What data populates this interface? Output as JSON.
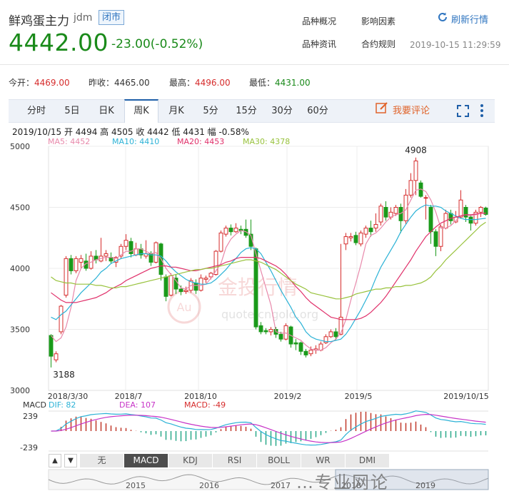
{
  "header": {
    "name": "鲜鸡蛋主力",
    "code": "jdm",
    "status": "闭市",
    "price": "4442.00",
    "change": "-23.00(-0.52%)",
    "links": [
      "品种概况",
      "影响因素",
      "品种资讯",
      "合约规则"
    ],
    "refresh_label": "刷新行情",
    "timestamp": "2019-10-15 11:29:59"
  },
  "stats": [
    {
      "label": "今开：",
      "value": "4469.00",
      "color": "#d62c2c"
    },
    {
      "label": "昨收：",
      "value": "4465.00",
      "color": "#333333"
    },
    {
      "label": "最高：",
      "value": "4496.00",
      "color": "#d62c2c"
    },
    {
      "label": "最低：",
      "value": "4431.00",
      "color": "#1a8a1a"
    }
  ],
  "tabs": [
    "分时",
    "5日",
    "日K",
    "周K",
    "月K",
    "5分",
    "15分",
    "30分",
    "60分"
  ],
  "active_tab": "周K",
  "comment_label": "我要评论",
  "ohlc_line": "2019/10/15 开 4494 高 4505 收 4442 低 4431 幅 -0.58%",
  "ma_legend": [
    {
      "text": "MA5: 4452",
      "color": "#e889ab"
    },
    {
      "text": "MA10: 4410",
      "color": "#2bb2d6"
    },
    {
      "text": "MA20: 4453",
      "color": "#e0306a"
    },
    {
      "text": "MA30: 4378",
      "color": "#98c23c"
    }
  ],
  "watermark": {
    "cn": "金投行情",
    "en": "quote.cngold.org",
    "badge": "Au"
  },
  "chart_data": {
    "type": "candlestick",
    "y_ticks": [
      "5000",
      "4500",
      "4000",
      "3500",
      "3000"
    ],
    "ylim": [
      3000,
      5000
    ],
    "x_ticks": [
      "2018/3/30",
      "2018/7",
      "2018/10",
      "2019/2",
      "2019/5",
      "2019/10/15"
    ],
    "annotations": {
      "high": "4908",
      "low": "3188"
    },
    "candles": [
      [
        3450,
        3280,
        3460,
        3188
      ],
      [
        3250,
        3300,
        3320,
        3230
      ],
      [
        3480,
        3690,
        3700,
        3460
      ],
      [
        3780,
        4080,
        4100,
        3760
      ],
      [
        4080,
        3980,
        4110,
        3950
      ],
      [
        3980,
        4080,
        4100,
        3960
      ],
      [
        4050,
        4080,
        4110,
        4000
      ],
      [
        4060,
        4000,
        4120,
        3980
      ],
      [
        4000,
        4100,
        4140,
        3990
      ],
      [
        4100,
        4070,
        4150,
        4040
      ],
      [
        4060,
        4100,
        4250,
        4050
      ],
      [
        4100,
        4120,
        4150,
        4060
      ],
      [
        4090,
        4060,
        4130,
        4040
      ],
      [
        4050,
        4090,
        4100,
        4010
      ],
      [
        4100,
        4180,
        4200,
        4080
      ],
      [
        4180,
        4230,
        4280,
        4150
      ],
      [
        4220,
        4120,
        4250,
        4090
      ],
      [
        4110,
        4160,
        4210,
        4100
      ],
      [
        4160,
        4110,
        4200,
        4080
      ],
      [
        4100,
        4120,
        4230,
        4080
      ],
      [
        4120,
        4050,
        4140,
        4020
      ],
      [
        4050,
        4210,
        4220,
        4040
      ],
      [
        4200,
        3950,
        4210,
        3900
      ],
      [
        3930,
        3770,
        3950,
        3730
      ],
      [
        3780,
        3940,
        3960,
        3770
      ],
      [
        3920,
        3830,
        3950,
        3790
      ],
      [
        3830,
        3810,
        3860,
        3780
      ],
      [
        3810,
        3820,
        3850,
        3790
      ],
      [
        3820,
        3900,
        3920,
        3800
      ],
      [
        3880,
        3820,
        3910,
        3790
      ],
      [
        3820,
        3920,
        3950,
        3810
      ],
      [
        3910,
        3920,
        3940,
        3880
      ],
      [
        3930,
        3960,
        3970,
        3910
      ],
      [
        3950,
        4140,
        4150,
        3940
      ],
      [
        4140,
        4290,
        4310,
        4130
      ],
      [
        4280,
        4330,
        4350,
        4260
      ],
      [
        4330,
        4300,
        4360,
        4270
      ],
      [
        4300,
        4330,
        4370,
        4290
      ],
      [
        4320,
        4310,
        4350,
        4280
      ],
      [
        4320,
        4270,
        4400,
        4250
      ],
      [
        4280,
        4180,
        4400,
        4150
      ],
      [
        4160,
        3520,
        4170,
        3500
      ],
      [
        3530,
        3480,
        3560,
        3460
      ],
      [
        3490,
        3480,
        3510,
        3460
      ],
      [
        3480,
        3500,
        3520,
        3450
      ],
      [
        3500,
        3460,
        3520,
        3430
      ],
      [
        3460,
        3420,
        3480,
        3400
      ],
      [
        3420,
        3530,
        3550,
        3410
      ],
      [
        3520,
        3380,
        3530,
        3350
      ],
      [
        3390,
        3380,
        3420,
        3330
      ],
      [
        3390,
        3320,
        3400,
        3290
      ],
      [
        3320,
        3290,
        3340,
        3270
      ],
      [
        3300,
        3330,
        3360,
        3280
      ],
      [
        3330,
        3340,
        3370,
        3300
      ],
      [
        3330,
        3380,
        3400,
        3320
      ],
      [
        3390,
        3440,
        3460,
        3380
      ],
      [
        3440,
        3480,
        3500,
        3430
      ],
      [
        3480,
        3440,
        3510,
        3410
      ],
      [
        3460,
        3600,
        4200,
        3450
      ],
      [
        4200,
        4260,
        4290,
        4150
      ],
      [
        4250,
        4260,
        4290,
        4220
      ],
      [
        4270,
        4210,
        4300,
        4190
      ],
      [
        4200,
        4290,
        4310,
        4180
      ],
      [
        4280,
        4330,
        4350,
        4250
      ],
      [
        4330,
        4300,
        4390,
        4260
      ],
      [
        4330,
        4360,
        4450,
        4300
      ],
      [
        4380,
        4510,
        4530,
        4350
      ],
      [
        4500,
        4420,
        4550,
        4390
      ],
      [
        4420,
        4460,
        4500,
        4400
      ],
      [
        4450,
        4500,
        4520,
        4430
      ],
      [
        4500,
        4390,
        4530,
        4290
      ],
      [
        4390,
        4600,
        4650,
        4360
      ],
      [
        4600,
        4720,
        4780,
        4580
      ],
      [
        4720,
        4880,
        4908,
        4600
      ],
      [
        4700,
        4590,
        4720,
        4580
      ],
      [
        4580,
        4580,
        4600,
        4400
      ],
      [
        4500,
        4300,
        4520,
        4200
      ],
      [
        4300,
        4180,
        4320,
        4100
      ],
      [
        4180,
        4340,
        4360,
        4140
      ],
      [
        4330,
        4450,
        4480,
        4320
      ],
      [
        4450,
        4390,
        4480,
        4360
      ],
      [
        4380,
        4420,
        4470,
        4370
      ],
      [
        4420,
        4560,
        4640,
        4410
      ],
      [
        4500,
        4420,
        4520,
        4380
      ],
      [
        4420,
        4370,
        4440,
        4310
      ],
      [
        4370,
        4460,
        4480,
        4350
      ],
      [
        4460,
        4500,
        4510,
        4420
      ],
      [
        4494,
        4442,
        4505,
        4431
      ]
    ],
    "series": [
      {
        "name": "MA5",
        "color": "#e889ab",
        "values": [
          3450,
          3400,
          3430,
          3520,
          3680,
          3900,
          4000,
          4040,
          4050,
          4070,
          4080,
          4090,
          4090,
          4080,
          4110,
          4140,
          4140,
          4160,
          4160,
          4140,
          4120,
          4130,
          4080,
          4000,
          3950,
          3900,
          3840,
          3830,
          3860,
          3860,
          3860,
          3870,
          3920,
          3980,
          4040,
          4170,
          4240,
          4280,
          4310,
          4300,
          4270,
          4120,
          3980,
          3840,
          3700,
          3480,
          3470,
          3470,
          3450,
          3430,
          3410,
          3370,
          3340,
          3330,
          3330,
          3350,
          3390,
          3420,
          3470,
          3580,
          3740,
          3880,
          4030,
          4200,
          4270,
          4290,
          4330,
          4380,
          4420,
          4440,
          4450,
          4480,
          4560,
          4640,
          4650,
          4630,
          4560,
          4460,
          4330,
          4330,
          4350,
          4390,
          4430,
          4440,
          4430,
          4440,
          4450,
          4452
        ]
      },
      {
        "name": "MA10",
        "color": "#2bb2d6",
        "values": [
          3600,
          3580,
          3620,
          3650,
          3700,
          3750,
          3800,
          3840,
          3880,
          3920,
          3970,
          4000,
          4040,
          4060,
          4080,
          4090,
          4100,
          4110,
          4120,
          4120,
          4110,
          4110,
          4100,
          4060,
          4010,
          3970,
          3940,
          3910,
          3890,
          3880,
          3870,
          3870,
          3880,
          3910,
          3950,
          3990,
          4040,
          4080,
          4130,
          4160,
          4170,
          4160,
          4120,
          4050,
          3980,
          3900,
          3820,
          3750,
          3680,
          3600,
          3550,
          3480,
          3440,
          3420,
          3410,
          3400,
          3400,
          3410,
          3420,
          3460,
          3520,
          3590,
          3660,
          3740,
          3820,
          3920,
          4010,
          4080,
          4150,
          4220,
          4300,
          4360,
          4420,
          4470,
          4500,
          4520,
          4510,
          4510,
          4500,
          4470,
          4450,
          4430,
          4410,
          4400,
          4400,
          4400,
          4405,
          4410
        ]
      },
      {
        "name": "MA20",
        "color": "#e0306a",
        "values": [
          3800,
          3770,
          3740,
          3720,
          3720,
          3720,
          3730,
          3740,
          3750,
          3760,
          3780,
          3800,
          3830,
          3850,
          3870,
          3900,
          3920,
          3940,
          3960,
          3980,
          4000,
          4010,
          4020,
          4020,
          4010,
          4010,
          4000,
          3990,
          3980,
          3980,
          3990,
          4000,
          4010,
          4020,
          4030,
          4050,
          4060,
          4080,
          4090,
          4090,
          4090,
          4090,
          4080,
          4060,
          4040,
          4020,
          3990,
          3950,
          3900,
          3850,
          3810,
          3760,
          3720,
          3690,
          3660,
          3630,
          3600,
          3590,
          3580,
          3580,
          3580,
          3580,
          3590,
          3610,
          3640,
          3680,
          3720,
          3770,
          3830,
          3890,
          3950,
          4010,
          4070,
          4140,
          4200,
          4260,
          4300,
          4340,
          4370,
          4390,
          4410,
          4420,
          4430,
          4440,
          4440,
          4445,
          4450,
          4453
        ]
      },
      {
        "name": "MA30",
        "color": "#98c23c",
        "values": [
          3930,
          3900,
          3890,
          3880,
          3880,
          3870,
          3870,
          3870,
          3870,
          3860,
          3860,
          3850,
          3840,
          3840,
          3850,
          3850,
          3860,
          3870,
          3880,
          3890,
          3900,
          3910,
          3920,
          3930,
          3940,
          3950,
          3960,
          3970,
          3980,
          3990,
          3990,
          4000,
          4000,
          4010,
          4020,
          4030,
          4040,
          4050,
          4060,
          4070,
          4070,
          4060,
          4050,
          4030,
          4010,
          3990,
          3960,
          3930,
          3900,
          3870,
          3850,
          3830,
          3800,
          3790,
          3780,
          3770,
          3760,
          3750,
          3750,
          3760,
          3770,
          3790,
          3800,
          3810,
          3820,
          3830,
          3830,
          3840,
          3840,
          3850,
          3850,
          3860,
          3860,
          3870,
          3880,
          3900,
          3930,
          3980,
          4020,
          4070,
          4110,
          4150,
          4190,
          4230,
          4270,
          4310,
          4350,
          4378
        ]
      }
    ],
    "macd_panel": {
      "title": "MACD",
      "legend": [
        {
          "text": "DIF: 82",
          "color": "#2bb2d6"
        },
        {
          "text": "DEA: 107",
          "color": "#c733c7"
        },
        {
          "text": "MACD: -49",
          "color": "#d62c2c"
        }
      ],
      "y_ticks": [
        "239",
        "-239"
      ]
    },
    "indicator_tabs": [
      "无",
      "MACD",
      "KDJ",
      "RSI",
      "BOLL",
      "WR",
      "DMI"
    ],
    "active_indicator": "MACD",
    "overview_years": [
      "2015",
      "2016",
      "2017",
      "2018",
      "2019"
    ]
  },
  "bottom_watermark": "…专业网论"
}
